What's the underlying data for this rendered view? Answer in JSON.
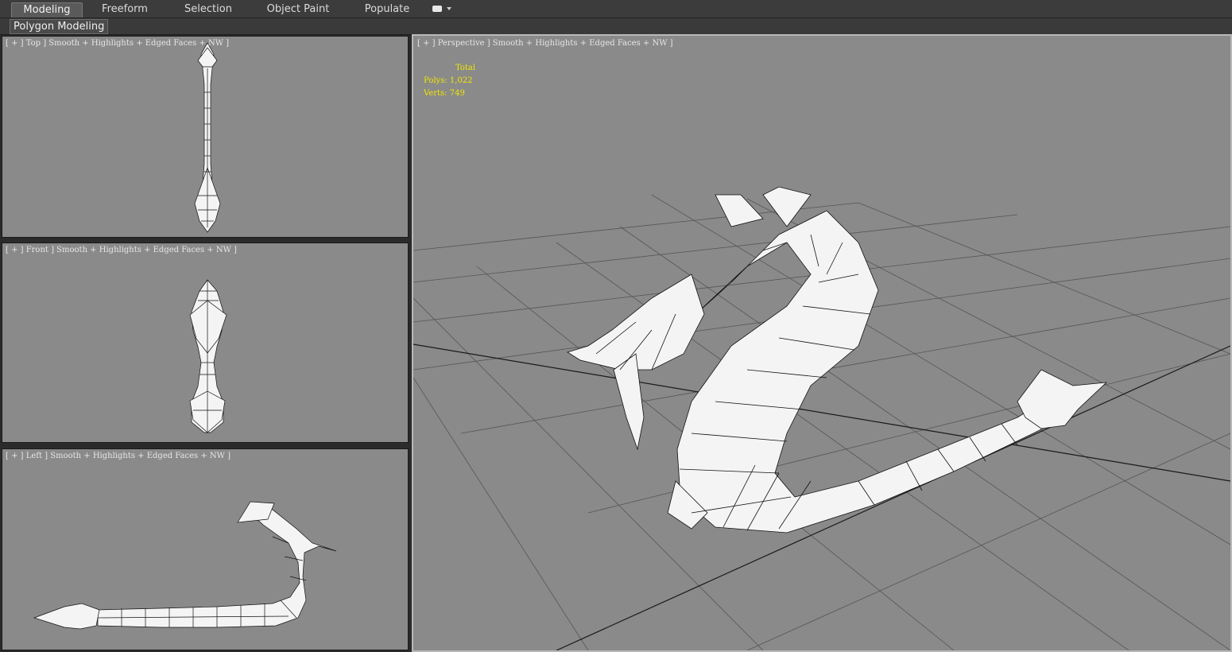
{
  "ribbon": {
    "tabs": [
      {
        "label": "Modeling",
        "active": true
      },
      {
        "label": "Freeform",
        "active": false
      },
      {
        "label": "Selection",
        "active": false
      },
      {
        "label": "Object Paint",
        "active": false
      },
      {
        "label": "Populate",
        "active": false
      }
    ],
    "options_icon": "ribbon-options-icon",
    "panel_label": "Polygon Modeling"
  },
  "viewports": {
    "top": {
      "label": "[ + ] Top ] Smooth + Highlights + Edged Faces + NW ]"
    },
    "front": {
      "label": "[ + ] Front ] Smooth + Highlights + Edged Faces + NW ]"
    },
    "left": {
      "label": "[ + ] Left ] Smooth + Highlights + Edged Faces + NW ]"
    },
    "perspective": {
      "label": "[ + ] Perspective ] Smooth + Highlights + Edged Faces + NW ]",
      "stats": {
        "header": "Total",
        "polys_label": "Polys:",
        "polys_value": "1,022",
        "verts_label": "Verts:",
        "verts_value": "749"
      }
    }
  },
  "colors": {
    "viewport_bg": "#8a8a8a",
    "active_border": "#b9b9b9",
    "stats_text": "#f2e600",
    "model_fill": "#f4f4f4",
    "wire": "#111111"
  }
}
